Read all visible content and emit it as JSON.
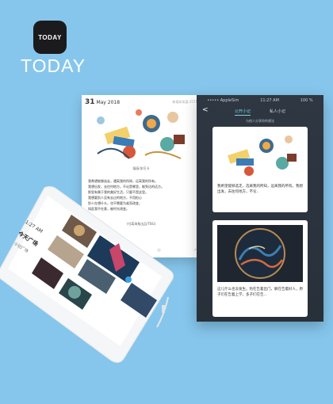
{
  "logo": {
    "icon_text": "TODAY",
    "brand_text": "TODAY"
  },
  "article": {
    "date_day": "31",
    "date_rest": "May 2018",
    "meta": "新媒体发展·2575",
    "caption": "插画/安可卡",
    "paragraph_lines": [
      "我希望能够选走，遇离我的所知，远离我的所有。",
      "我想出发，去往何地方，不论是哪里，能到达的远方。",
      "那里有属于我的美好生活，只要不是这里。",
      "我想要别人没有去过的地方，不用担心",
      "别人在想什么，也不需要为谁而改变，",
      "如此我不在意，被时光改变。"
    ],
    "footer": "(付离海角出品/TBG)",
    "tools": [
      "◁",
      "♡",
      "◎",
      "↗"
    ]
  },
  "screen": {
    "carrier": "••••• AppleSim",
    "time": "11:27 AM",
    "battery": "100 %",
    "back": "<",
    "tab_public": "公开小记",
    "tab_private": "私人小记",
    "subtitle": "与他人分享你的想法",
    "card1_text": "我希望能够选走，选离我的所知，远离我的所有。我想出发，去往何地方，不论..",
    "card2_text": "这儿什么也没发生。豹在告着出门，解在告着好人，原子们在告着上学，多子们在告..."
  },
  "phone": {
    "status_time": "1:27 AM",
    "section_title": "今天广场",
    "sub_label": "小记广场"
  },
  "colors": {
    "background": "#86c6ec",
    "dark_screen": "#2b333c",
    "accent": "#7fd3e0"
  }
}
